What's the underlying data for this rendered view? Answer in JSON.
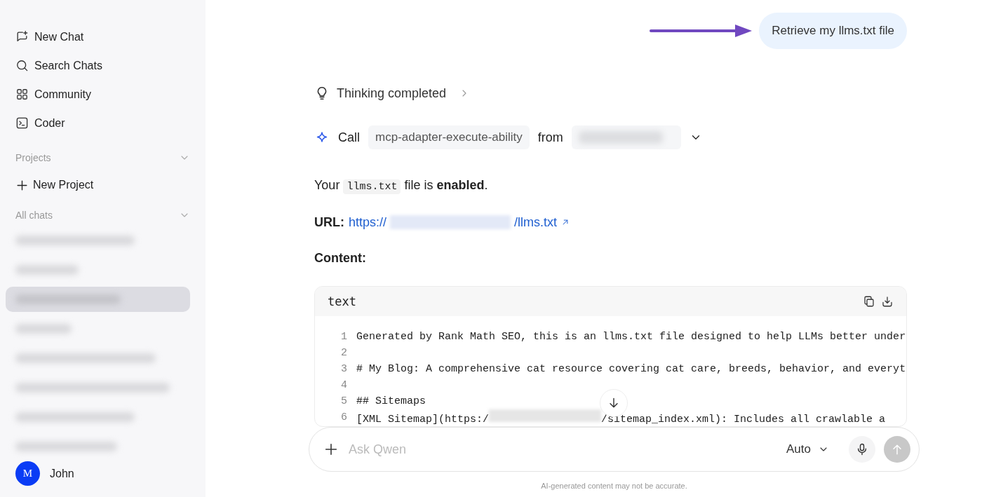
{
  "sidebar": {
    "nav_items": [
      {
        "kind": "new-chat",
        "label": "New Chat"
      },
      {
        "kind": "search",
        "label": "Search Chats"
      },
      {
        "kind": "community",
        "label": "Community"
      },
      {
        "kind": "coder",
        "label": "Coder"
      }
    ],
    "projects_label": "Projects",
    "new_project": "New Project",
    "all_chats_label": "All chats",
    "chats": [
      {
        "selected": false
      },
      {
        "selected": false
      },
      {
        "selected": true
      },
      {
        "selected": false
      },
      {
        "selected": false
      },
      {
        "selected": false
      },
      {
        "selected": false
      },
      {
        "selected": false
      }
    ],
    "user": {
      "avatar_letter": "M",
      "name": "John"
    }
  },
  "conversation": {
    "user_message": "Retrieve my llms.txt file",
    "thinking": "Thinking completed",
    "tool_call": {
      "verb": "Call",
      "tool": "mcp-adapter-execute-ability",
      "from": "from"
    },
    "status": {
      "before": "Your",
      "code": "llms.txt",
      "after": "file is **enabled**."
    },
    "url": {
      "label": "URL:",
      "prefix": "https://",
      "suffix": "/llms.txt"
    },
    "content_label": "Content:",
    "code_block": {
      "language": "text",
      "lines": [
        {
          "number": "1",
          "text": "Generated by Rank Math SEO, this is an llms.txt file designed to help LLMs better under"
        },
        {
          "number": "2"
        },
        {
          "number": "3",
          "text": "# My Blog: A comprehensive cat resource covering cat care, breeds, behavior, and everyt"
        },
        {
          "number": "4"
        },
        {
          "number": "5",
          "text": "## Sitemaps"
        },
        {
          "number": "6",
          "text": "[XML Sitemap](https:/",
          "after_redaction": "/sitemap_index.xml): Includes all crawlable a"
        }
      ]
    }
  },
  "composer": {
    "placeholder": "Ask Qwen",
    "model": "Auto"
  },
  "disclaimer": "AI-generated content may not be accurate."
}
